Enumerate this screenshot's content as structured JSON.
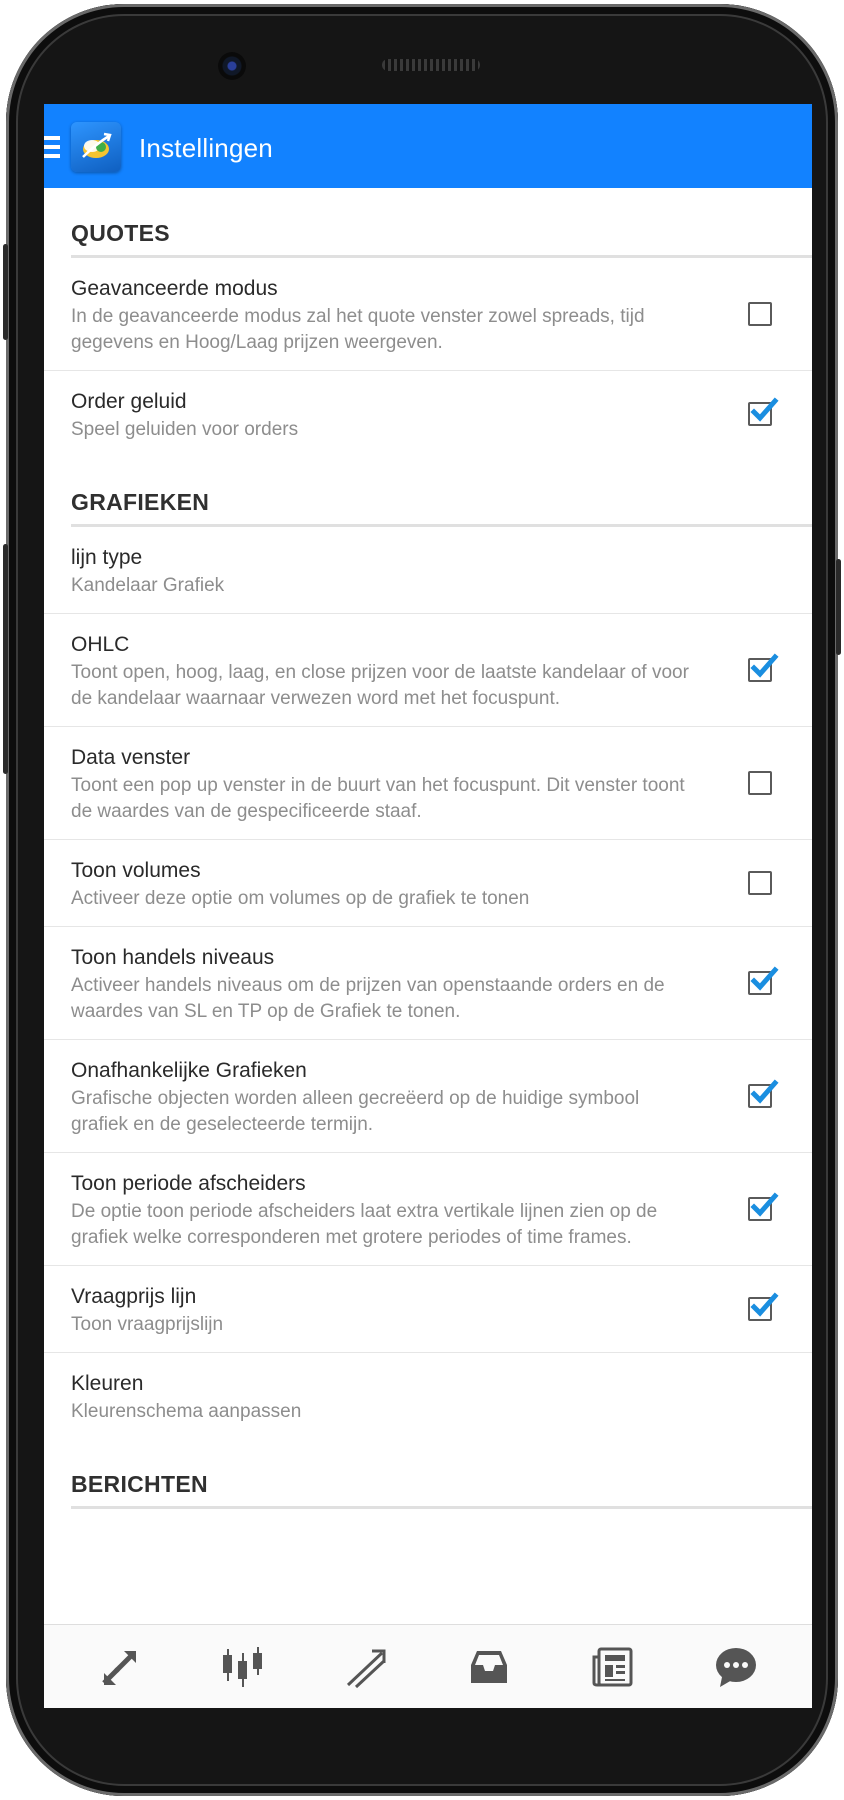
{
  "app": {
    "title": "Instellingen"
  },
  "sections": [
    {
      "title": "QUOTES",
      "items": [
        {
          "title": "Geavanceerde modus",
          "subtitle": "In de geavanceerde modus zal het quote venster zowel spreads, tijd gegevens en Hoog/Laag prijzen weergeven.",
          "checked": false
        },
        {
          "title": "Order geluid",
          "subtitle": "Speel geluiden voor orders",
          "checked": true
        }
      ]
    },
    {
      "title": "GRAFIEKEN",
      "items": [
        {
          "title": "lijn type",
          "subtitle": "Kandelaar Grafiek"
        },
        {
          "title": "OHLC",
          "subtitle": "Toont open, hoog, laag, en close prijzen voor de laatste kandelaar of voor de kandelaar waarnaar verwezen word met het focuspunt.",
          "checked": true
        },
        {
          "title": "Data venster",
          "subtitle": "Toont een pop up venster in de buurt van het focuspunt. Dit venster toont de waardes van de gespecificeerde staaf.",
          "checked": false
        },
        {
          "title": "Toon volumes",
          "subtitle": "Activeer deze optie om volumes op de grafiek te tonen",
          "checked": false
        },
        {
          "title": "Toon handels niveaus",
          "subtitle": "Activeer handels niveaus om de prijzen van openstaande orders en de waardes van SL en TP op de Grafiek te tonen.",
          "checked": true
        },
        {
          "title": "Onafhankelijke Grafieken",
          "subtitle": "Grafische objecten worden alleen gecreëerd op de huidige symbool grafiek en de geselecteerde termijn.",
          "checked": true
        },
        {
          "title": "Toon periode afscheiders",
          "subtitle": "De optie toon periode afscheiders laat extra vertikale lijnen zien op de grafiek welke corresponderen met grotere periodes of time frames.",
          "checked": true
        },
        {
          "title": "Vraagprijs lijn",
          "subtitle": "Toon vraagprijslijn",
          "checked": true
        },
        {
          "title": "Kleuren",
          "subtitle": "Kleurenschema aanpassen"
        }
      ]
    },
    {
      "title": "BERICHTEN",
      "items": []
    }
  ],
  "bottom_nav": [
    {
      "icon": "quotes-icon"
    },
    {
      "icon": "chart-icon"
    },
    {
      "icon": "trade-icon"
    },
    {
      "icon": "history-icon"
    },
    {
      "icon": "news-icon"
    },
    {
      "icon": "chat-icon"
    }
  ],
  "colors": {
    "app_bar": "#1282ff",
    "checkmark": "#1a8ee0"
  }
}
